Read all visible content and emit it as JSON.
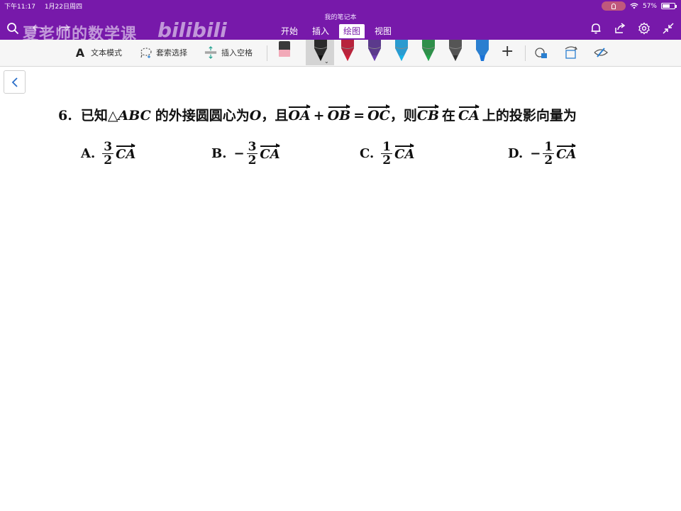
{
  "status_bar": {
    "time": "下午11:17",
    "date": "1月22日周四",
    "battery": "57%"
  },
  "notebook_title": "我的笔记本",
  "watermark": {
    "channel": "夏老师的数学课",
    "logo": "bilibili"
  },
  "ribbon": {
    "tabs": [
      {
        "label": "开始"
      },
      {
        "label": "插入"
      },
      {
        "label": "绘图"
      },
      {
        "label": "视图"
      }
    ],
    "active_tab": "绘图"
  },
  "toolbar": {
    "text_mode": "文本模式",
    "lasso_select": "套索选择",
    "insert_space": "插入空格",
    "text_mode_glyph": "A",
    "plus": "+"
  },
  "pens": [
    {
      "color": "#2a2a2a",
      "tip": "#111111",
      "selected": true
    },
    {
      "color": "#b8243c",
      "tip": "#d0203a"
    },
    {
      "color": "#5b3a8c",
      "tip": "#6c3fb0"
    },
    {
      "color": "#2a9bd0",
      "tip": "#16b3e8"
    },
    {
      "color": "#2f8f4a",
      "tip": "#22a84c"
    },
    {
      "color": "#555555",
      "tip": "#333333"
    },
    {
      "color": "#2b7fd0",
      "tip": "#1a73d8"
    }
  ],
  "question": {
    "number": "6.",
    "text_before": "已知",
    "triangle_symbol": "△",
    "triangle_name": "ABC",
    "text_mid": "的外接圆圆心为",
    "center": "O",
    "comma_and": "，且",
    "vec_oa": "OA",
    "plus": "+",
    "vec_ob": "OB",
    "equals": "=",
    "vec_oc": "OC",
    "comma_then": "，则",
    "vec_cb": "CB",
    "word_on": "在",
    "vec_ca": "CA",
    "text_end": "上的投影向量为"
  },
  "options": {
    "a": {
      "letter": "A.",
      "sign": "",
      "numerator": "3",
      "denominator": "2",
      "vector": "CA"
    },
    "b": {
      "letter": "B.",
      "sign": "−",
      "numerator": "3",
      "denominator": "2",
      "vector": "CA"
    },
    "c": {
      "letter": "C.",
      "sign": "",
      "numerator": "1",
      "denominator": "2",
      "vector": "CA"
    },
    "d": {
      "letter": "D.",
      "sign": "−",
      "numerator": "1",
      "denominator": "2",
      "vector": "CA"
    }
  },
  "colors": {
    "header": "#7719aa",
    "toolbar": "#f6f6f6"
  }
}
